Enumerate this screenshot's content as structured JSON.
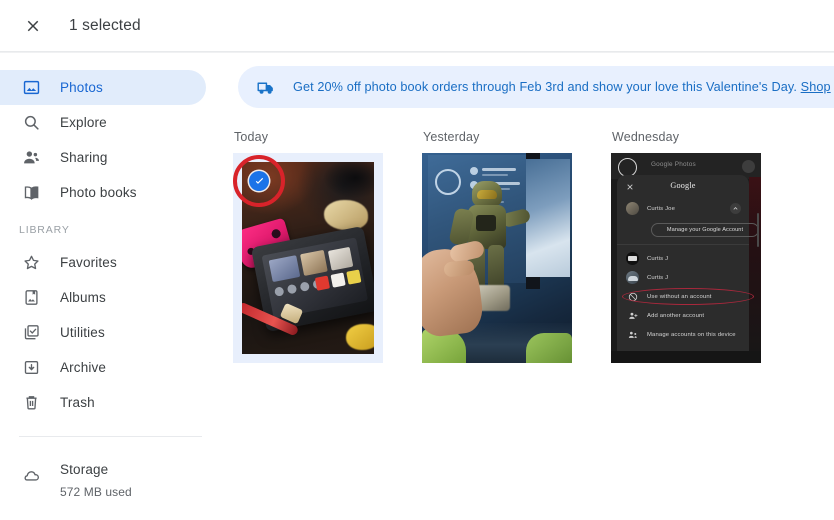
{
  "topbar": {
    "close_icon": "close-icon",
    "title": "1 selected"
  },
  "sidebar": {
    "primary_items": [
      {
        "label": "Photos",
        "icon": "photo-icon",
        "active": true
      },
      {
        "label": "Explore",
        "icon": "search-icon",
        "active": false
      },
      {
        "label": "Sharing",
        "icon": "people-icon",
        "active": false
      },
      {
        "label": "Photo books",
        "icon": "open-book-icon",
        "active": false
      }
    ],
    "library_label": "LIBRARY",
    "library_items": [
      {
        "label": "Favorites",
        "icon": "star-icon"
      },
      {
        "label": "Albums",
        "icon": "album-icon"
      },
      {
        "label": "Utilities",
        "icon": "checked-stack-icon"
      },
      {
        "label": "Archive",
        "icon": "archive-icon"
      },
      {
        "label": "Trash",
        "icon": "trash-icon"
      }
    ],
    "storage": {
      "icon": "cloud-icon",
      "title": "Storage",
      "used": "572 MB used"
    }
  },
  "banner": {
    "icon": "delivery-truck-icon",
    "text": "Get 20% off photo book orders through Feb 3rd and show your love this Valentine's Day. ",
    "link_label": "Shop"
  },
  "groups": [
    {
      "title": "Today",
      "photo": {
        "name": "nintendo-switch-on-desk",
        "selected": true,
        "check_icon": "check-icon",
        "annotation": "red-circle-highlight"
      }
    },
    {
      "title": "Yesterday",
      "photo": {
        "name": "hand-holding-master-chief-figure",
        "selected": false
      }
    },
    {
      "title": "Wednesday",
      "photo": {
        "name": "google-photos-account-switcher-screenshot",
        "selected": false,
        "annotation": "red-ellipse-highlight",
        "screenshot_content": {
          "app_title": "Google Photos",
          "sheet_title": "Google",
          "close_icon": "close-icon",
          "account_name": "Curtis Joe",
          "collapse_icon": "chevron-up-icon",
          "manage_button": "Manage your Google Account",
          "menu_items": [
            {
              "label": "Curtis J",
              "icon": "account-avatar-icon"
            },
            {
              "label": "Curtis J",
              "icon": "account-avatar-icon"
            },
            {
              "label": "Use without an account",
              "icon": "no-account-icon",
              "highlighted": true
            },
            {
              "label": "Add another account",
              "icon": "person-add-icon"
            },
            {
              "label": "Manage accounts on this device",
              "icon": "manage-accounts-icon"
            }
          ]
        }
      }
    }
  ],
  "colors": {
    "accent_blue": "#1a73e8",
    "active_pill": "#e1ecfb",
    "banner_bg": "#e8f0fe",
    "banner_text": "#1a6ec4",
    "selection_frame": "#e8effc",
    "annotation_red": "#d8232a",
    "text_primary": "#3c4043",
    "text_secondary": "#5f6368"
  }
}
